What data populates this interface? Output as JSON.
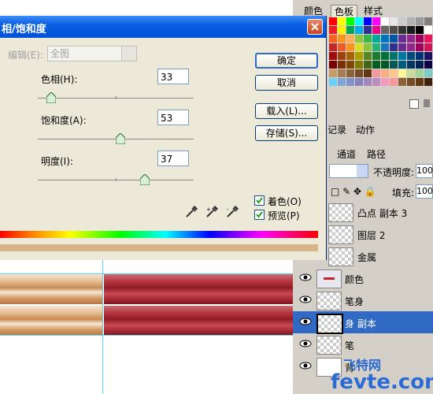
{
  "dialog": {
    "title": "相/饱和度",
    "edit_label": "编辑(E):",
    "edit_value": "全图",
    "hue_label": "色相(H):",
    "hue_value": "33",
    "sat_label": "饱和度(A):",
    "sat_value": "53",
    "light_label": "明度(I):",
    "light_value": "37",
    "ok": "确定",
    "cancel": "取消",
    "load": "载入(L)...",
    "save": "存储(S)...",
    "colorize": "着色(O)",
    "preview": "预览(P)",
    "colorize_checked": true,
    "preview_checked": true
  },
  "swatch_panel": {
    "tabs": [
      "颜色",
      "色板",
      "样式"
    ]
  },
  "layers_panel": {
    "tabs": [
      "记录",
      "动作"
    ],
    "tabs2": [
      "通道",
      "路径"
    ],
    "opacity_label": "不透明度:",
    "opacity_value": "100",
    "fill_label": "填充:",
    "fill_value": "100",
    "layers": [
      {
        "name": "凸点 副本 3"
      },
      {
        "name": "图层 2"
      },
      {
        "name": "金属"
      },
      {
        "name": "颜色"
      },
      {
        "name": "笔身"
      },
      {
        "name": "身 副本"
      },
      {
        "name": "笔"
      },
      {
        "name": "背"
      }
    ]
  },
  "watermark": {
    "text": "fevte.com",
    "cn": "飞特网"
  }
}
